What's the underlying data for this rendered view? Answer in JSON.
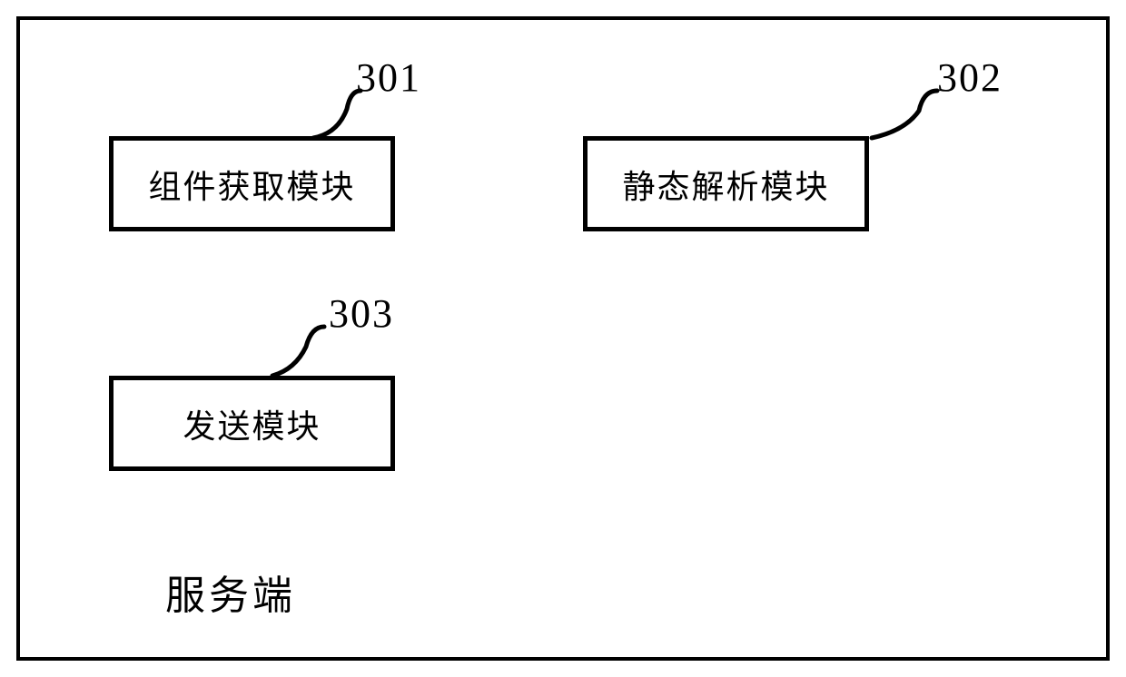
{
  "container": {
    "label": "服务端"
  },
  "modules": {
    "m301": {
      "number": "301",
      "title": "组件获取模块"
    },
    "m302": {
      "number": "302",
      "title": "静态解析模块"
    },
    "m303": {
      "number": "303",
      "title": "发送模块"
    }
  }
}
